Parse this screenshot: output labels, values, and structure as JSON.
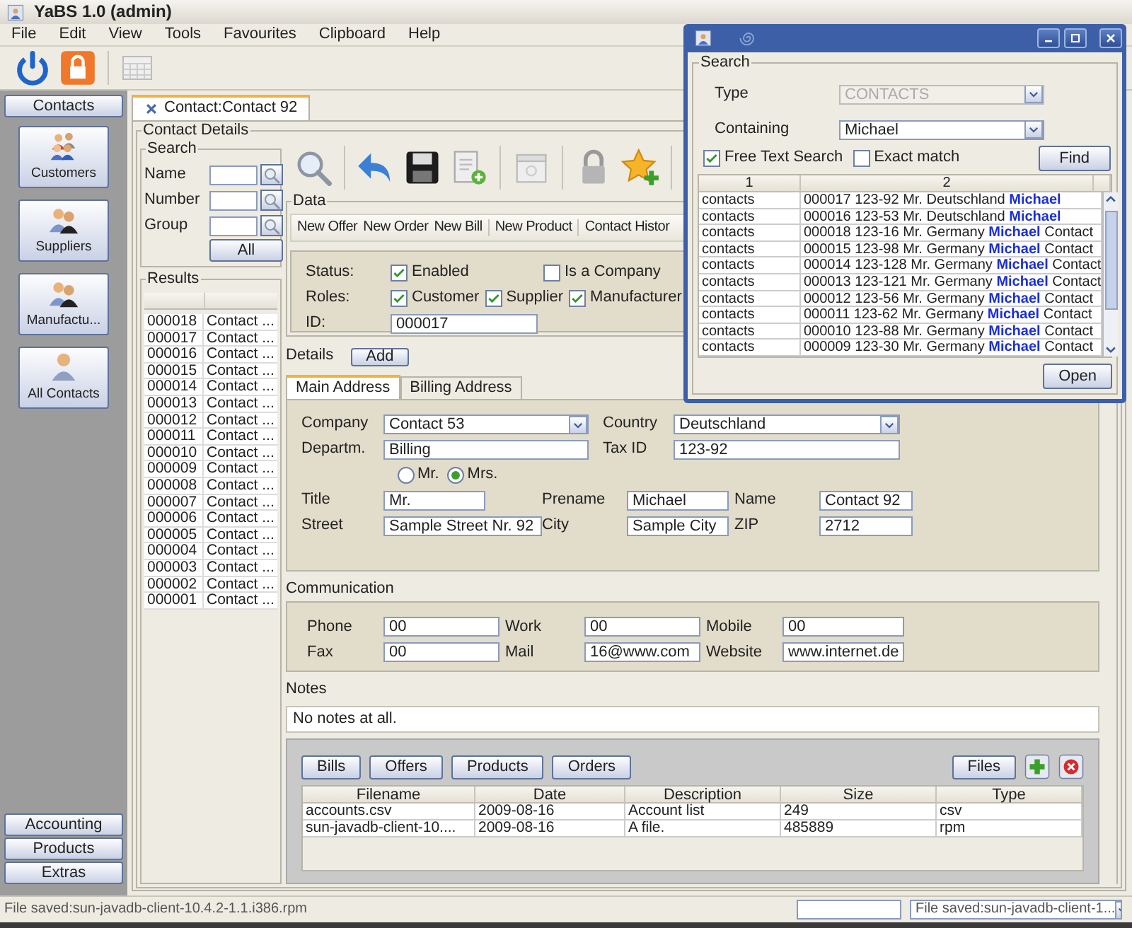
{
  "window": {
    "title": "YaBS 1.0 (admin)"
  },
  "menu": [
    "File",
    "Edit",
    "View",
    "Tools",
    "Favourites",
    "Clipboard",
    "Help"
  ],
  "sidebar": {
    "section": "Contacts",
    "items": [
      "Customers",
      "Suppliers",
      "Manufactu...",
      "All Contacts"
    ],
    "sections": [
      "Accounting",
      "Products",
      "Extras"
    ]
  },
  "tabs": [
    {
      "label": "Contact:Contact 92",
      "selected": true
    }
  ],
  "contact_details": {
    "title": "Contact Details",
    "search": {
      "title": "Search",
      "fields": [
        "Name",
        "Number",
        "Group"
      ],
      "all_button": "All"
    },
    "results": {
      "title": "Results",
      "rows": [
        [
          "000018",
          "Contact ..."
        ],
        [
          "000017",
          "Contact ..."
        ],
        [
          "000016",
          "Contact ..."
        ],
        [
          "000015",
          "Contact ..."
        ],
        [
          "000014",
          "Contact ..."
        ],
        [
          "000013",
          "Contact ..."
        ],
        [
          "000012",
          "Contact ..."
        ],
        [
          "000011",
          "Contact ..."
        ],
        [
          "000010",
          "Contact ..."
        ],
        [
          "000009",
          "Contact ..."
        ],
        [
          "000008",
          "Contact ..."
        ],
        [
          "000007",
          "Contact ..."
        ],
        [
          "000006",
          "Contact ..."
        ],
        [
          "000005",
          "Contact ..."
        ],
        [
          "000004",
          "Contact ..."
        ],
        [
          "000003",
          "Contact ..."
        ],
        [
          "000002",
          "Contact ..."
        ],
        [
          "000001",
          "Contact ..."
        ]
      ]
    },
    "data": {
      "title": "Data",
      "actions": [
        "New Offer",
        "New Order",
        "New Bill",
        "New Product",
        "Contact Histor"
      ],
      "status_label": "Status:",
      "status": [
        {
          "label": "Enabled",
          "checked": true
        },
        {
          "label": "Is a Company",
          "checked": false
        }
      ],
      "roles_label": "Roles:",
      "roles": [
        {
          "label": "Customer",
          "checked": true
        },
        {
          "label": "Supplier",
          "checked": true
        },
        {
          "label": "Manufacturer",
          "checked": true
        }
      ],
      "id_label": "ID:",
      "id": "000017"
    },
    "details": {
      "title": "Details",
      "add_button": "Add",
      "tabs": [
        {
          "label": "Main Address",
          "selected": true
        },
        {
          "label": "Billing Address",
          "selected": false
        }
      ],
      "rows": [
        [
          {
            "label": "Company",
            "value": "Contact 53",
            "kind": "combo"
          },
          {
            "label": "Country",
            "value": "Deutschland",
            "kind": "combo"
          }
        ],
        [
          {
            "label": "Departm.",
            "value": "Billing",
            "kind": "text"
          },
          {
            "label": "Tax ID",
            "value": "123-92",
            "kind": "text"
          }
        ]
      ],
      "salutation": [
        {
          "label": "Mr.",
          "selected": false
        },
        {
          "label": "Mrs.",
          "selected": true
        }
      ],
      "person_rows": [
        [
          {
            "label": "Title",
            "value": "Mr."
          },
          {
            "label": "Prename",
            "value": "Michael"
          },
          {
            "label": "Name",
            "value": "Contact 92"
          }
        ],
        [
          {
            "label": "Street",
            "value": "Sample Street Nr. 92"
          },
          {
            "label": "City",
            "value": "Sample City"
          },
          {
            "label": "ZIP",
            "value": "2712"
          }
        ]
      ]
    },
    "communication": {
      "title": "Communication",
      "rows": [
        [
          {
            "label": "Phone",
            "value": "00"
          },
          {
            "label": "Work",
            "value": "00"
          },
          {
            "label": "Mobile",
            "value": "00"
          }
        ],
        [
          {
            "label": "Fax",
            "value": "00"
          },
          {
            "label": "Mail",
            "value": "16@www.com"
          },
          {
            "label": "Website",
            "value": "www.internet.de"
          }
        ]
      ]
    },
    "notes": {
      "title": "Notes",
      "text": "No notes at all."
    },
    "documents": {
      "buttons": [
        "Bills",
        "Offers",
        "Products",
        "Orders"
      ],
      "files_button": "Files",
      "columns": [
        "Filename",
        "Date",
        "Description",
        "Size",
        "Type"
      ],
      "rows": [
        [
          "accounts.csv",
          "2009-08-16",
          "Account list",
          "249",
          "csv"
        ],
        [
          "sun-javadb-client-10....",
          "2009-08-16",
          "A file.",
          "485889",
          "rpm"
        ]
      ]
    }
  },
  "status_bar": {
    "message": "File saved:sun-javadb-client-10.4.2-1.1.i386.rpm",
    "log_selector": "File saved:sun-javadb-client-1..."
  },
  "search_window": {
    "section": "Search",
    "type_label": "Type",
    "type": {
      "value": "CONTACTS",
      "disabled": true
    },
    "containing_label": "Containing",
    "containing": "Michael",
    "options": [
      {
        "label": "Free Text Search",
        "checked": true
      },
      {
        "label": "Exact match",
        "checked": false
      }
    ],
    "find_button": "Find",
    "columns": [
      "1",
      "2"
    ],
    "rows": [
      [
        "contacts",
        "000017 123-92 Mr. Deutschland **Michael**"
      ],
      [
        "contacts",
        "000016 123-53 Mr. Deutschland **Michael**"
      ],
      [
        "contacts",
        "000018 123-16 Mr. Germany **Michael** Contact"
      ],
      [
        "contacts",
        "000015 123-98 Mr. Germany **Michael** Contact"
      ],
      [
        "contacts",
        "000014 123-128 Mr. Germany **Michael** Contact"
      ],
      [
        "contacts",
        "000013 123-121 Mr. Germany **Michael** Contact"
      ],
      [
        "contacts",
        "000012 123-56 Mr. Germany **Michael** Contact"
      ],
      [
        "contacts",
        "000011 123-62 Mr. Germany **Michael** Contact"
      ],
      [
        "contacts",
        "000010 123-88 Mr. Germany **Michael** Contact"
      ],
      [
        "contacts",
        "000009 123-30 Mr. Germany **Michael** Contact"
      ]
    ],
    "open_button": "Open"
  }
}
